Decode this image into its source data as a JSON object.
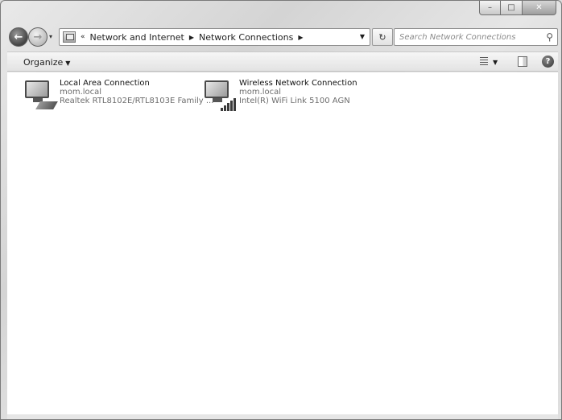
{
  "window": {
    "caption_buttons": {
      "minimize": "–",
      "maximize": "□",
      "close": "✕"
    }
  },
  "nav": {
    "back": "←",
    "forward": "→",
    "recent": "▾",
    "breadcrumb_overflow": "«",
    "breadcrumbs": [
      "Network and Internet",
      "Network Connections"
    ],
    "refresh": "↻",
    "search_placeholder": "Search Network Connections"
  },
  "commandbar": {
    "organize_label": "Organize",
    "help": "?"
  },
  "connections": [
    {
      "name": "Local Area Connection",
      "network": "mom.local",
      "adapter": "Realtek RTL8102E/RTL8103E Family ...",
      "icon": "wired-network-icon"
    },
    {
      "name": "Wireless Network Connection",
      "network": "mom.local",
      "adapter": "Intel(R) WiFi Link 5100 AGN",
      "icon": "wireless-network-icon"
    }
  ]
}
